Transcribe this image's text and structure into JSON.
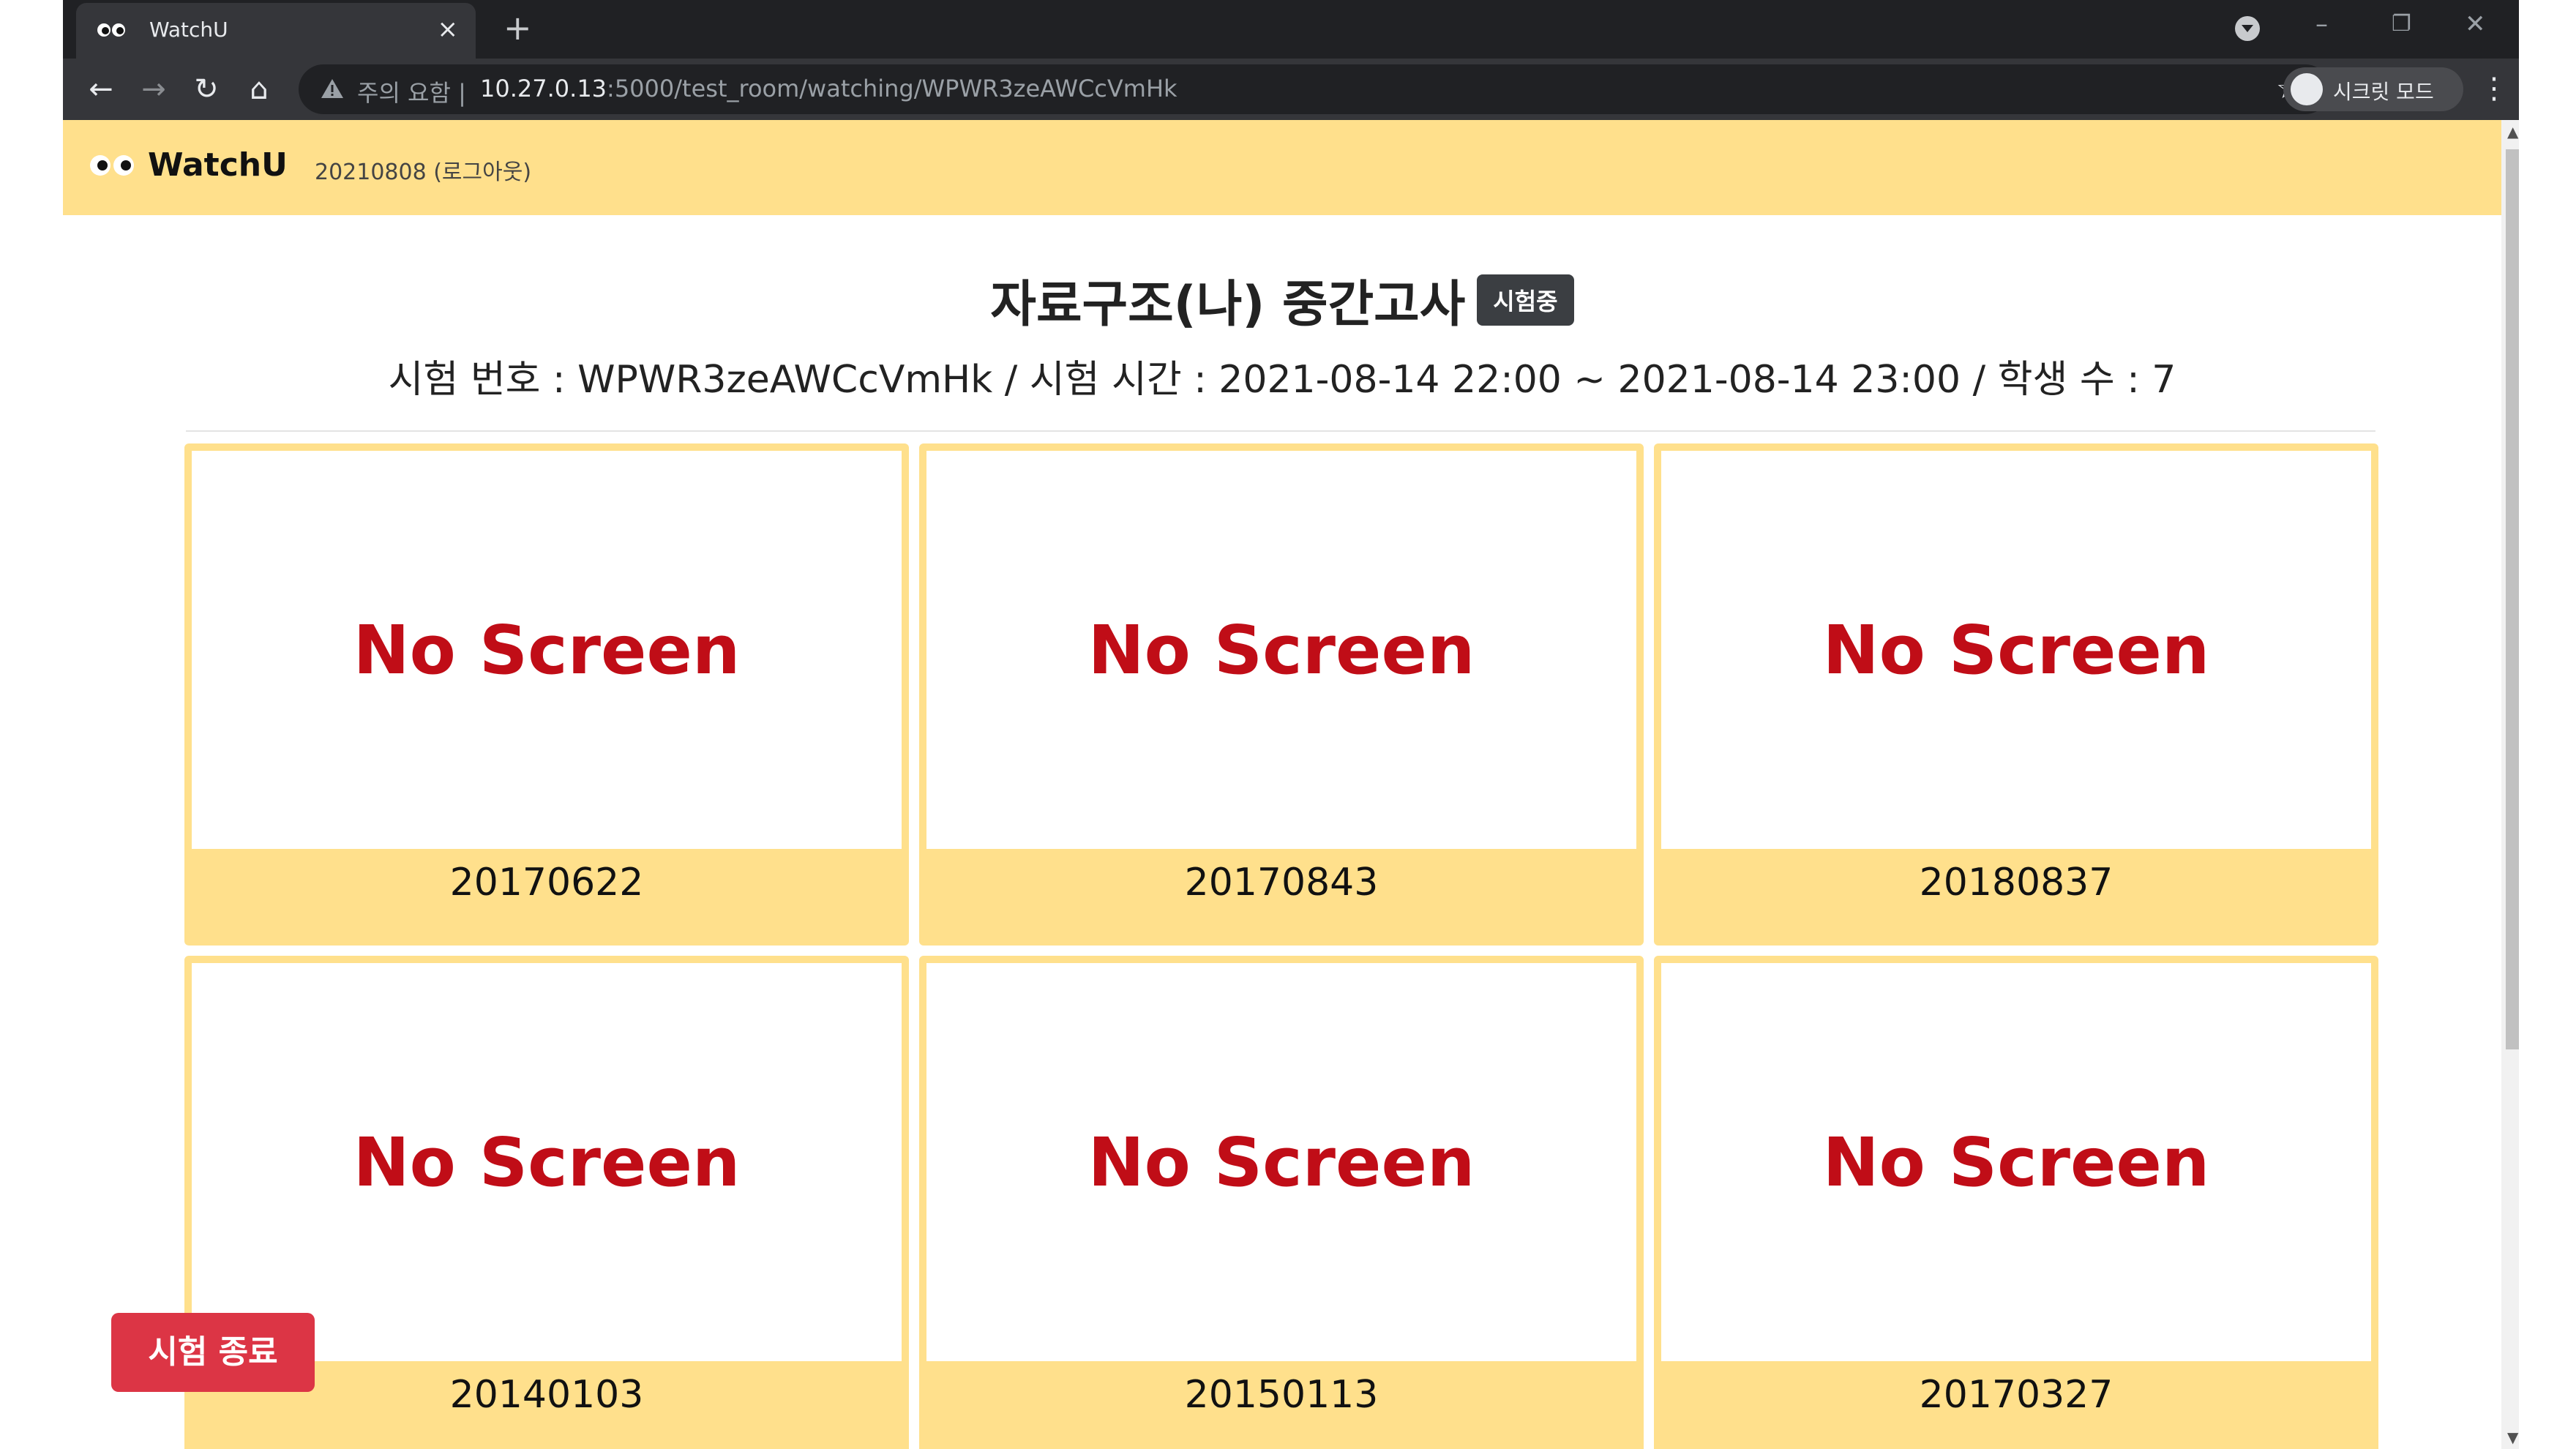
{
  "browser": {
    "tab_title": "WatchU",
    "tab_close": "×",
    "new_tab": "+",
    "url_warning": "주의 요함 |",
    "url_host": "10.27.0.13",
    "url_path": ":5000/test_room/watching/WPWR3zeAWCcVmHk",
    "incognito_label": "시크릿 모드",
    "icons": [
      "back-arrow-icon",
      "forward-arrow-icon",
      "reload-icon",
      "home-icon",
      "warning-icon",
      "star-icon",
      "incognito-icon",
      "kebab-menu-icon"
    ]
  },
  "navbar": {
    "brand": "WatchU",
    "user_link": "20210808 (로그아웃)",
    "color": "#ffe08c"
  },
  "exam": {
    "title": "자료구조(나) 중간고사",
    "status_badge": "시험중",
    "info": "시험 번호 : WPWR3zeAWCcVmHk / 시험 시간 : 2021-08-14 22:00 ~ 2021-08-14 23:00 / 학생 수 : 7"
  },
  "cards": [
    {
      "screen": "No Screen",
      "student_id": "20170622"
    },
    {
      "screen": "No Screen",
      "student_id": "20170843"
    },
    {
      "screen": "No Screen",
      "student_id": "20180837"
    },
    {
      "screen": "No Screen",
      "student_id": "20140103"
    },
    {
      "screen": "No Screen",
      "student_id": "20150113"
    },
    {
      "screen": "No Screen",
      "student_id": "20170327"
    }
  ],
  "end_button": {
    "label": "시험 종료",
    "color": "#dc3545"
  }
}
